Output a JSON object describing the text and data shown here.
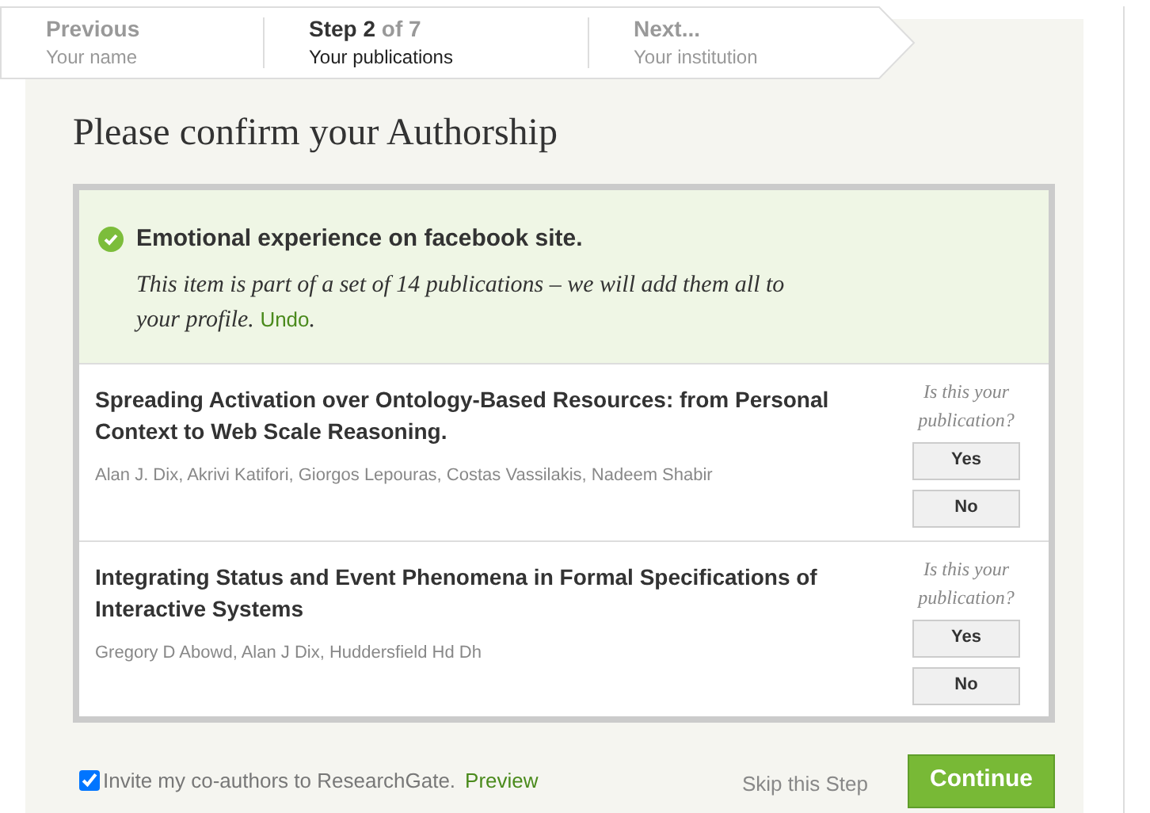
{
  "steps": [
    {
      "title": "Previous",
      "subtitle": "Your name",
      "selected": false
    },
    {
      "title": "Step 2",
      "suffix": "of 7",
      "subtitle": "Your publications",
      "selected": true
    },
    {
      "title": "Next...",
      "subtitle": "Your institution",
      "selected": false
    }
  ],
  "heading": "Please confirm your Authorship",
  "confirmed": {
    "title": "Emotional experience on facebook site.",
    "note": "This item is part of a set of 14 publications – we will add them all to your profile.",
    "link": "Undo",
    "note_end": "."
  },
  "publications": [
    {
      "title": "Spreading Activation over Ontology-Based Resources: from Personal Context to Web Scale Reasoning.",
      "authors": "Alan J. Dix, Akrivi Katifori, Giorgos Lepouras, Costas Vassilakis, Nadeem Shabir",
      "question": "Is this your publication?",
      "yes": "Yes",
      "no": "No"
    },
    {
      "title": "Integrating Status and Event Phenomena in Formal Specifications of Interactive Systems",
      "authors": "Gregory D Abowd, Alan J Dix, Huddersfield Hd Dh",
      "question": "Is this your publication?",
      "yes": "Yes",
      "no": "No"
    }
  ],
  "footer": {
    "invite": {
      "label": "Invite my co-authors to ResearchGate.",
      "link": "Preview",
      "checked": true
    },
    "skip": "Skip this Step",
    "continue": "Continue"
  }
}
